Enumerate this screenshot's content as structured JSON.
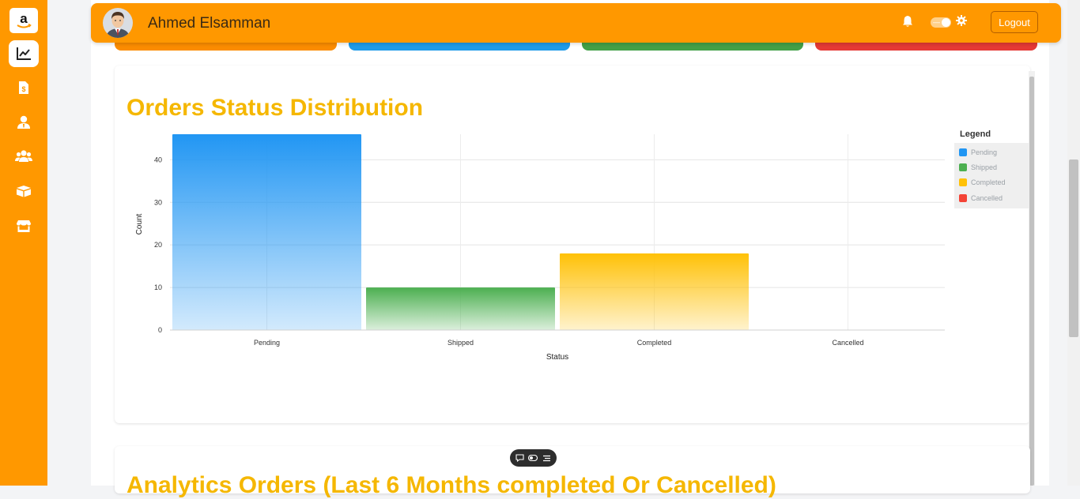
{
  "topbar": {
    "user_name": "Ahmed Elsamman",
    "logout_label": "Logout",
    "toggle_label": "—",
    "background": "#ff9800"
  },
  "sidebar": {
    "background": "#ff9800",
    "items": [
      {
        "name": "amazon-logo",
        "icon": "amazon-logo"
      },
      {
        "name": "analytics",
        "icon": "line-chart-icon",
        "active": true
      },
      {
        "name": "invoices",
        "icon": "invoice-dollar-icon"
      },
      {
        "name": "user",
        "icon": "user-tie-icon"
      },
      {
        "name": "users",
        "icon": "users-icon"
      },
      {
        "name": "products",
        "icon": "boxes-icon"
      },
      {
        "name": "store",
        "icon": "store-icon"
      }
    ]
  },
  "stat_cards": [
    {
      "color": "#fb8c00"
    },
    {
      "color": "#1e9be8"
    },
    {
      "color": "#43a047"
    },
    {
      "color": "#e53935"
    }
  ],
  "orders_chart": {
    "title": "Orders Status Distribution",
    "legend_title": "Legend"
  },
  "chart_data": {
    "type": "bar",
    "title": "Orders Status Distribution",
    "categories": [
      "Pending",
      "Shipped",
      "Completed",
      "Cancelled"
    ],
    "values": [
      46,
      10,
      18,
      0
    ],
    "colors": [
      "#2196f3",
      "#4caf50",
      "#ffc107",
      "#f44336"
    ],
    "xlabel": "Status",
    "ylabel": "Count",
    "ylim": [
      0,
      46
    ],
    "yticks": [
      0,
      10,
      20,
      30,
      40
    ],
    "grid": true,
    "legend": {
      "title": "Legend",
      "placement": "right",
      "entries": [
        "Pending",
        "Shipped",
        "Completed",
        "Cancelled"
      ]
    }
  },
  "analytics_card": {
    "title": "Analytics Orders (Last 6 Months completed Or Cancelled)"
  },
  "floating_toolbar": {
    "icons": [
      "comment-icon",
      "toggle-icon",
      "menu-icon"
    ]
  }
}
